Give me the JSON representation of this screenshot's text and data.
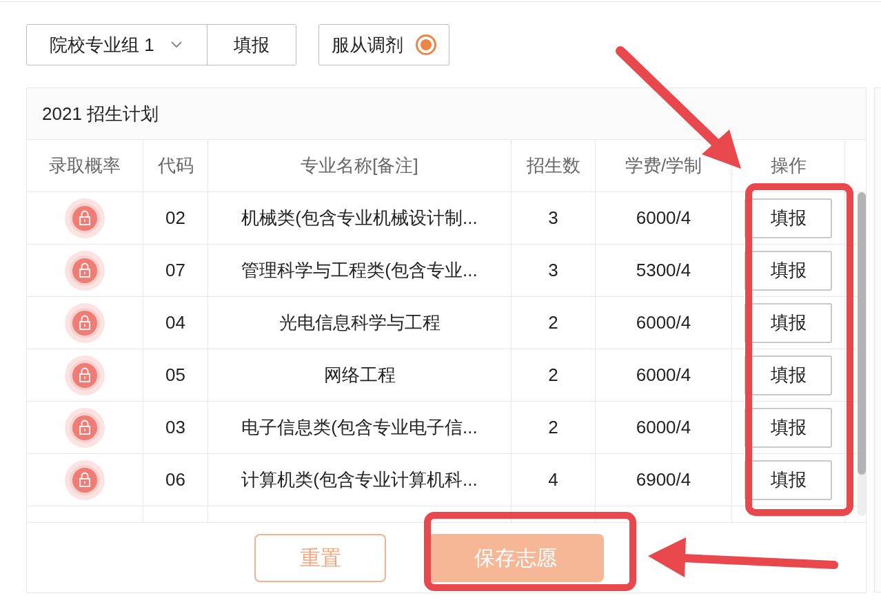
{
  "toolbar": {
    "group_select": {
      "value": "院校专业组 1"
    },
    "fill_button": "填报",
    "adjust": {
      "label": "服从调剂",
      "selected": true
    }
  },
  "plan": {
    "title": "2021 招生计划",
    "columns": [
      "录取概率",
      "代码",
      "专业名称[备注]",
      "招生数",
      "学费/学制",
      "操作"
    ],
    "rows": [
      {
        "code": "02",
        "name": "机械类(包含专业机械设计制...",
        "count": "3",
        "fee": "6000/4",
        "action": "填报"
      },
      {
        "code": "07",
        "name": "管理科学与工程类(包含专业...",
        "count": "3",
        "fee": "5300/4",
        "action": "填报"
      },
      {
        "code": "04",
        "name": "光电信息科学与工程",
        "count": "2",
        "fee": "6000/4",
        "action": "填报"
      },
      {
        "code": "05",
        "name": "网络工程",
        "count": "2",
        "fee": "6000/4",
        "action": "填报"
      },
      {
        "code": "03",
        "name": "电子信息类(包含专业电子信...",
        "count": "2",
        "fee": "6000/4",
        "action": "填报"
      },
      {
        "code": "06",
        "name": "计算机类(包含专业计算机科...",
        "count": "4",
        "fee": "6900/4",
        "action": "填报"
      }
    ],
    "footer_buttons": [
      {
        "kind": "outline",
        "label": "重置"
      },
      {
        "kind": "filled",
        "label": "保存志愿"
      }
    ]
  }
}
